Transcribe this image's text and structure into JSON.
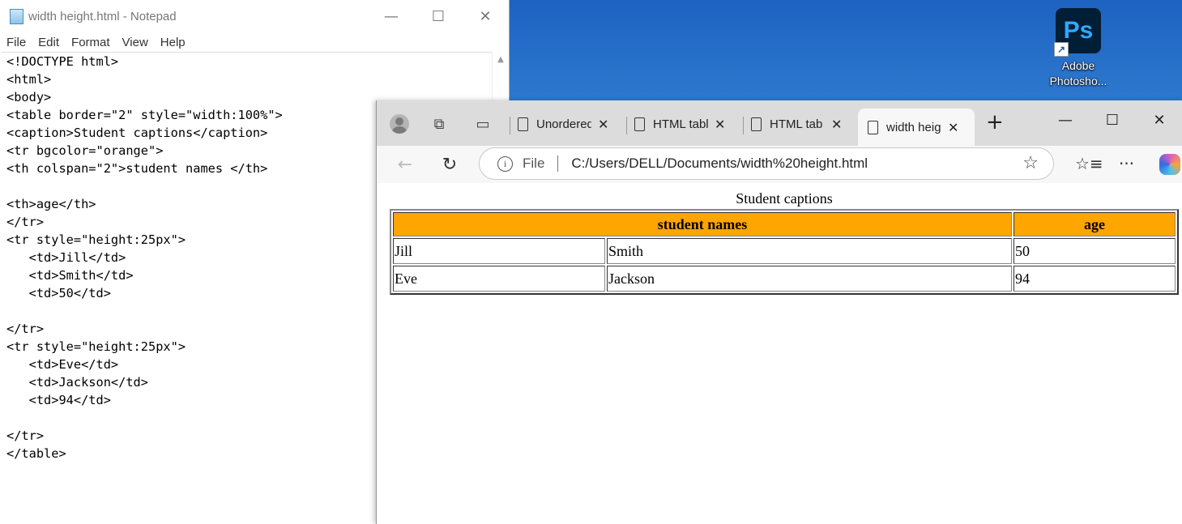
{
  "desktop": {
    "icon_label_line1": "Adobe",
    "icon_label_line2": "Photosho...",
    "icon_text": "Ps"
  },
  "notepad": {
    "title": "width height.html - Notepad",
    "menu": [
      "File",
      "Edit",
      "Format",
      "View",
      "Help"
    ],
    "window_buttons": {
      "minimize": "—",
      "maximize": "☐",
      "close": "✕"
    },
    "content": "<!DOCTYPE html>\n<html>\n<body>\n<table border=\"2\" style=\"width:100%\">\n<caption>Student captions</caption>\n<tr bgcolor=\"orange\">\n<th colspan=\"2\">student names </th>\n\n<th>age</th>\n</tr>\n<tr style=\"height:25px\">\n   <td>Jill</td>\n   <td>Smith</td>\n   <td>50</td>\n\n</tr>\n<tr style=\"height:25px\">\n   <td>Eve</td>\n   <td>Jackson</td>\n   <td>94</td>\n\n</tr>\n</table>"
  },
  "browser": {
    "tabs": [
      {
        "label": "Unordered",
        "active": false
      },
      {
        "label": "HTML tabl",
        "active": false
      },
      {
        "label": "HTML tab",
        "active": false
      },
      {
        "label": "width heig",
        "active": true
      }
    ],
    "new_tab": "+",
    "address": {
      "scheme_label": "File",
      "url": "C:/Users/DELL/Documents/width%20height.html"
    },
    "page": {
      "caption": "Student captions",
      "header_color": "#ffa500",
      "headers": [
        "student names",
        "age"
      ],
      "rows": [
        [
          "Jill",
          "Smith",
          "50"
        ],
        [
          "Eve",
          "Jackson",
          "94"
        ]
      ]
    }
  }
}
